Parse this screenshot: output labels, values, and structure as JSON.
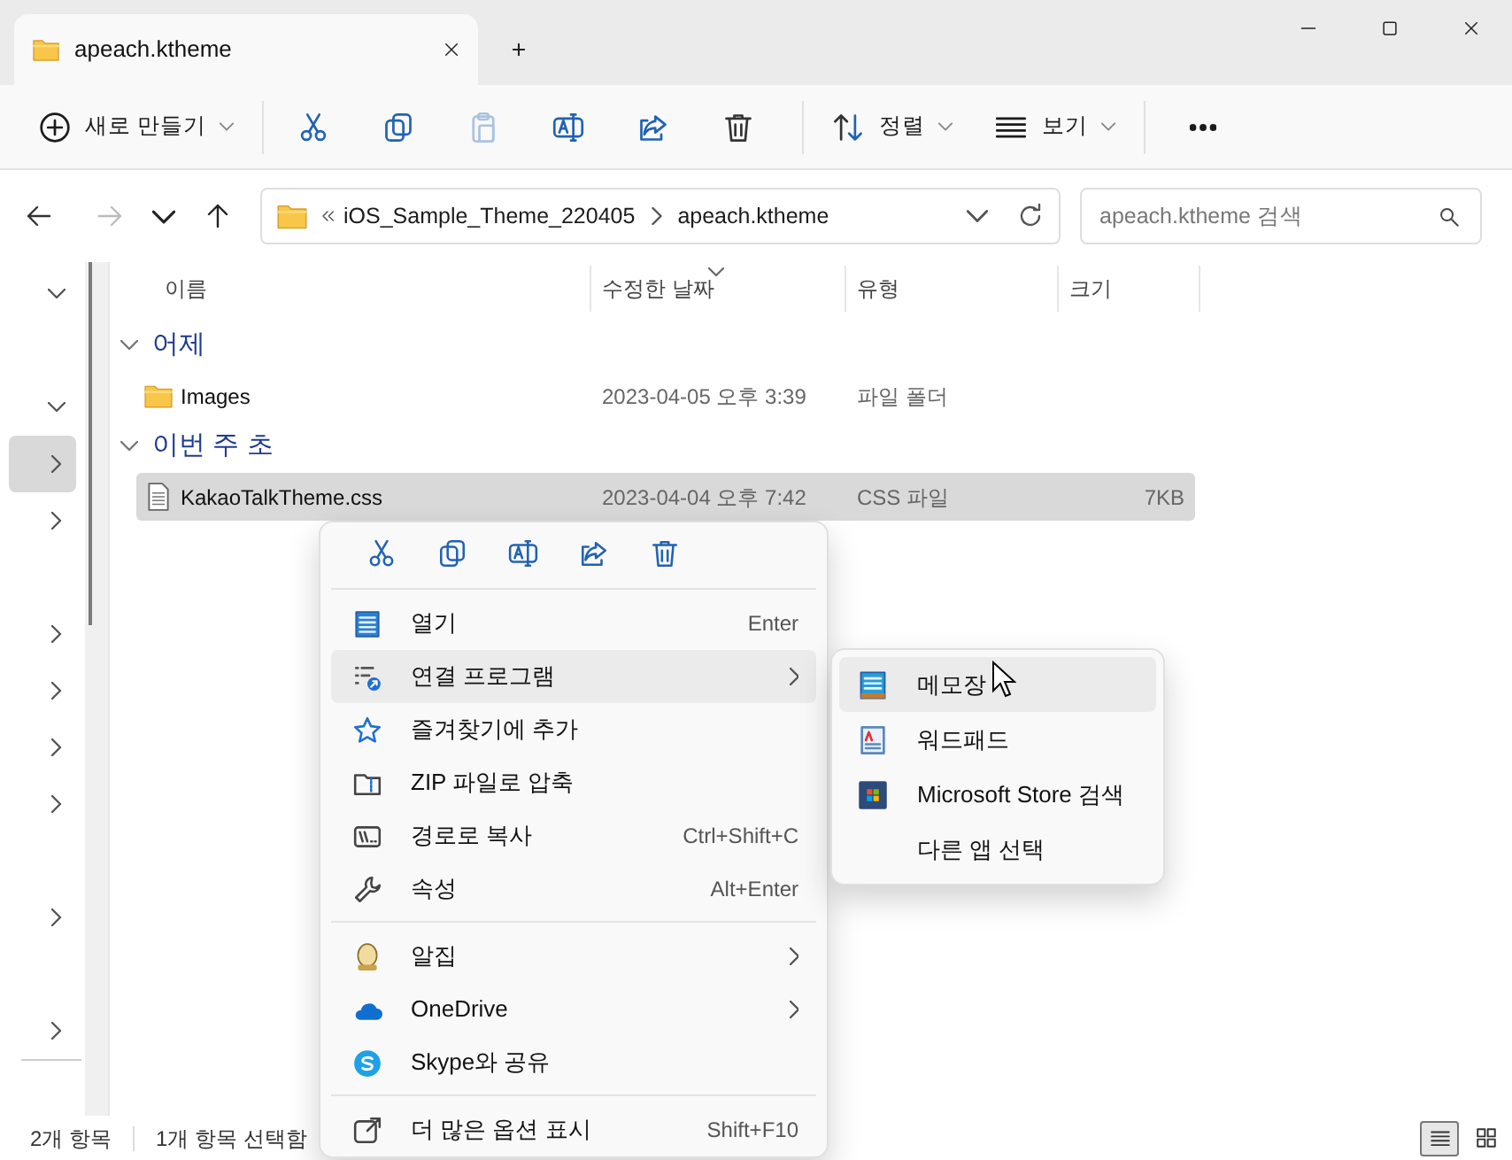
{
  "tab": {
    "title": "apeach.ktheme"
  },
  "toolbar": {
    "new_label": "새로 만들기",
    "actions": [
      {
        "kind": "cut",
        "disabled": false
      },
      {
        "kind": "copy",
        "disabled": false
      },
      {
        "kind": "paste",
        "disabled": true
      },
      {
        "kind": "rename",
        "disabled": false
      },
      {
        "kind": "share",
        "disabled": false
      },
      {
        "kind": "delete",
        "disabled": false
      }
    ],
    "sort_label": "정렬",
    "view_label": "보기"
  },
  "navigation": {
    "back_disabled": false,
    "forward_disabled": true
  },
  "address": {
    "path": [
      "iOS_Sample_Theme_220405",
      "apeach.ktheme"
    ]
  },
  "search": {
    "placeholder": "apeach.ktheme 검색"
  },
  "nav_pane": {
    "items": [
      {
        "kind": "toggle",
        "expanded": true,
        "selected": false
      },
      {
        "kind": "blank"
      },
      {
        "kind": "toggle",
        "expanded": true,
        "selected": false
      },
      {
        "kind": "toggle",
        "expanded": false,
        "selected": true
      },
      {
        "kind": "toggle",
        "expanded": false,
        "selected": false
      },
      {
        "kind": "blank"
      },
      {
        "kind": "toggle",
        "expanded": false,
        "selected": false
      },
      {
        "kind": "toggle",
        "expanded": false,
        "selected": false
      },
      {
        "kind": "toggle",
        "expanded": false,
        "selected": false
      },
      {
        "kind": "toggle",
        "expanded": false,
        "selected": false
      },
      {
        "kind": "blank"
      },
      {
        "kind": "toggle",
        "expanded": false,
        "selected": false
      },
      {
        "kind": "blank"
      },
      {
        "kind": "toggle",
        "expanded": false,
        "selected": false
      }
    ]
  },
  "columns": [
    {
      "label": "이름",
      "sorted": false
    },
    {
      "label": "수정한 날짜",
      "sorted": true
    },
    {
      "label": "유형",
      "sorted": false
    },
    {
      "label": "크기",
      "sorted": false
    }
  ],
  "groups": [
    {
      "title": "어제",
      "expanded": true,
      "files": [
        {
          "kind": "folder",
          "name": "Images",
          "modified": "2023-04-05 오후 3:39",
          "type": "파일 폴더",
          "selected": false
        }
      ]
    },
    {
      "title": "이번 주 초",
      "expanded": true,
      "files": [
        {
          "kind": "document",
          "name": "KakaoTalkTheme.css",
          "modified": "2023-04-04 오후 7:42",
          "type": "CSS 파일",
          "size": "7KB",
          "selected": true
        }
      ]
    }
  ],
  "context_menu": {
    "quick_actions": [
      {
        "kind": "cut"
      },
      {
        "kind": "copy"
      },
      {
        "kind": "rename"
      },
      {
        "kind": "share"
      },
      {
        "kind": "delete"
      }
    ],
    "sections": [
      {
        "items": [
          {
            "kind": "open",
            "label": "열기",
            "shortcut": "Enter",
            "has_submenu": false,
            "selected": false
          },
          {
            "kind": "open_with",
            "label": "연결 프로그램",
            "has_submenu": true,
            "selected": true,
            "submenu_items": [
              {
                "kind": "notepad",
                "label": "메모장",
                "selected": true
              },
              {
                "kind": "wordpad",
                "label": "워드패드",
                "selected": false
              },
              {
                "kind": "store",
                "label": "Microsoft Store 검색",
                "selected": false
              },
              {
                "kind": "none",
                "label": "다른 앱 선택",
                "selected": false
              }
            ]
          },
          {
            "kind": "favorite",
            "label": "즐겨찾기에 추가",
            "has_submenu": false,
            "selected": false
          },
          {
            "kind": "zip",
            "label": "ZIP 파일로 압축",
            "has_submenu": false,
            "selected": false
          },
          {
            "kind": "copy_path",
            "label": "경로로 복사",
            "shortcut": "Ctrl+Shift+C",
            "has_submenu": false,
            "selected": false
          },
          {
            "kind": "properties",
            "label": "속성",
            "shortcut": "Alt+Enter",
            "has_submenu": false,
            "selected": false
          }
        ]
      },
      {
        "items": [
          {
            "kind": "alzip",
            "label": "알집",
            "has_submenu": true,
            "selected": false
          },
          {
            "kind": "onedrive",
            "label": "OneDrive",
            "has_submenu": true,
            "selected": false
          },
          {
            "kind": "skype",
            "label": "Skype와 공유",
            "has_submenu": false,
            "selected": false
          }
        ]
      },
      {
        "items": [
          {
            "kind": "more_options",
            "label": "더 많은 옵션 표시",
            "shortcut": "Shift+F10",
            "has_submenu": false,
            "selected": false
          }
        ]
      }
    ]
  },
  "status_bar": {
    "item_count": "2개 항목",
    "selection": "1개 항목 선택함",
    "views": [
      {
        "kind": "details",
        "selected": true
      },
      {
        "kind": "tiles",
        "selected": false
      }
    ]
  }
}
